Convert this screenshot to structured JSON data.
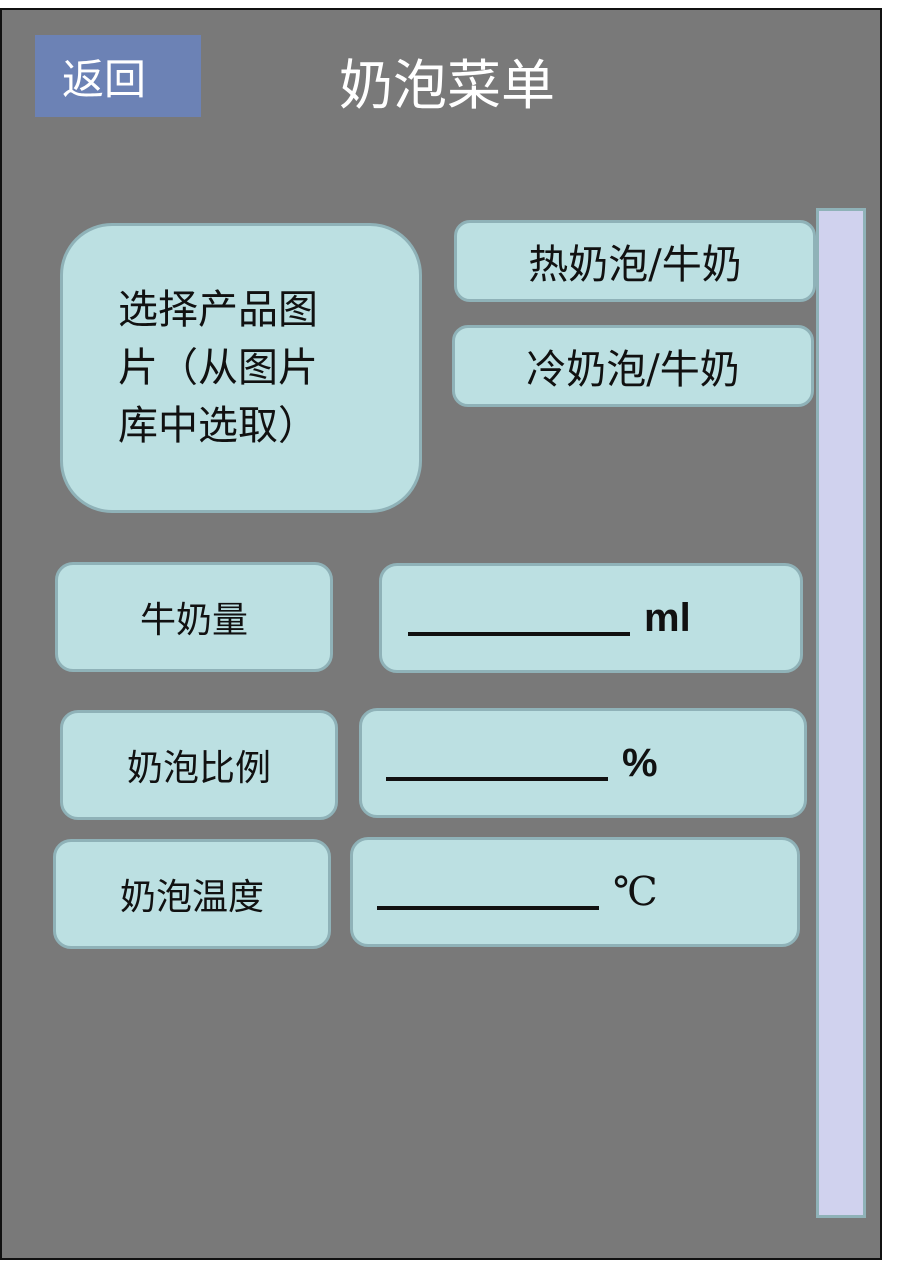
{
  "header": {
    "back_label": "返回",
    "title": "奶泡菜单"
  },
  "product_picker": {
    "line1": "选择产品图",
    "line2": "片（从图片",
    "line3": "库中选取）"
  },
  "modes": {
    "hot_label": "热奶泡/牛奶",
    "cold_label": "冷奶泡/牛奶"
  },
  "settings": {
    "milk_amount": {
      "label": "牛奶量",
      "value": "",
      "unit": "ml"
    },
    "foam_ratio": {
      "label": "奶泡比例",
      "value": "",
      "unit": "%"
    },
    "foam_temp": {
      "label": "奶泡温度",
      "value": "",
      "unit": "℃"
    }
  },
  "colors": {
    "background": "#797979",
    "card": "#bce0e2",
    "back_button": "#6c82b5",
    "scrollbar": "#d0d2ee"
  }
}
